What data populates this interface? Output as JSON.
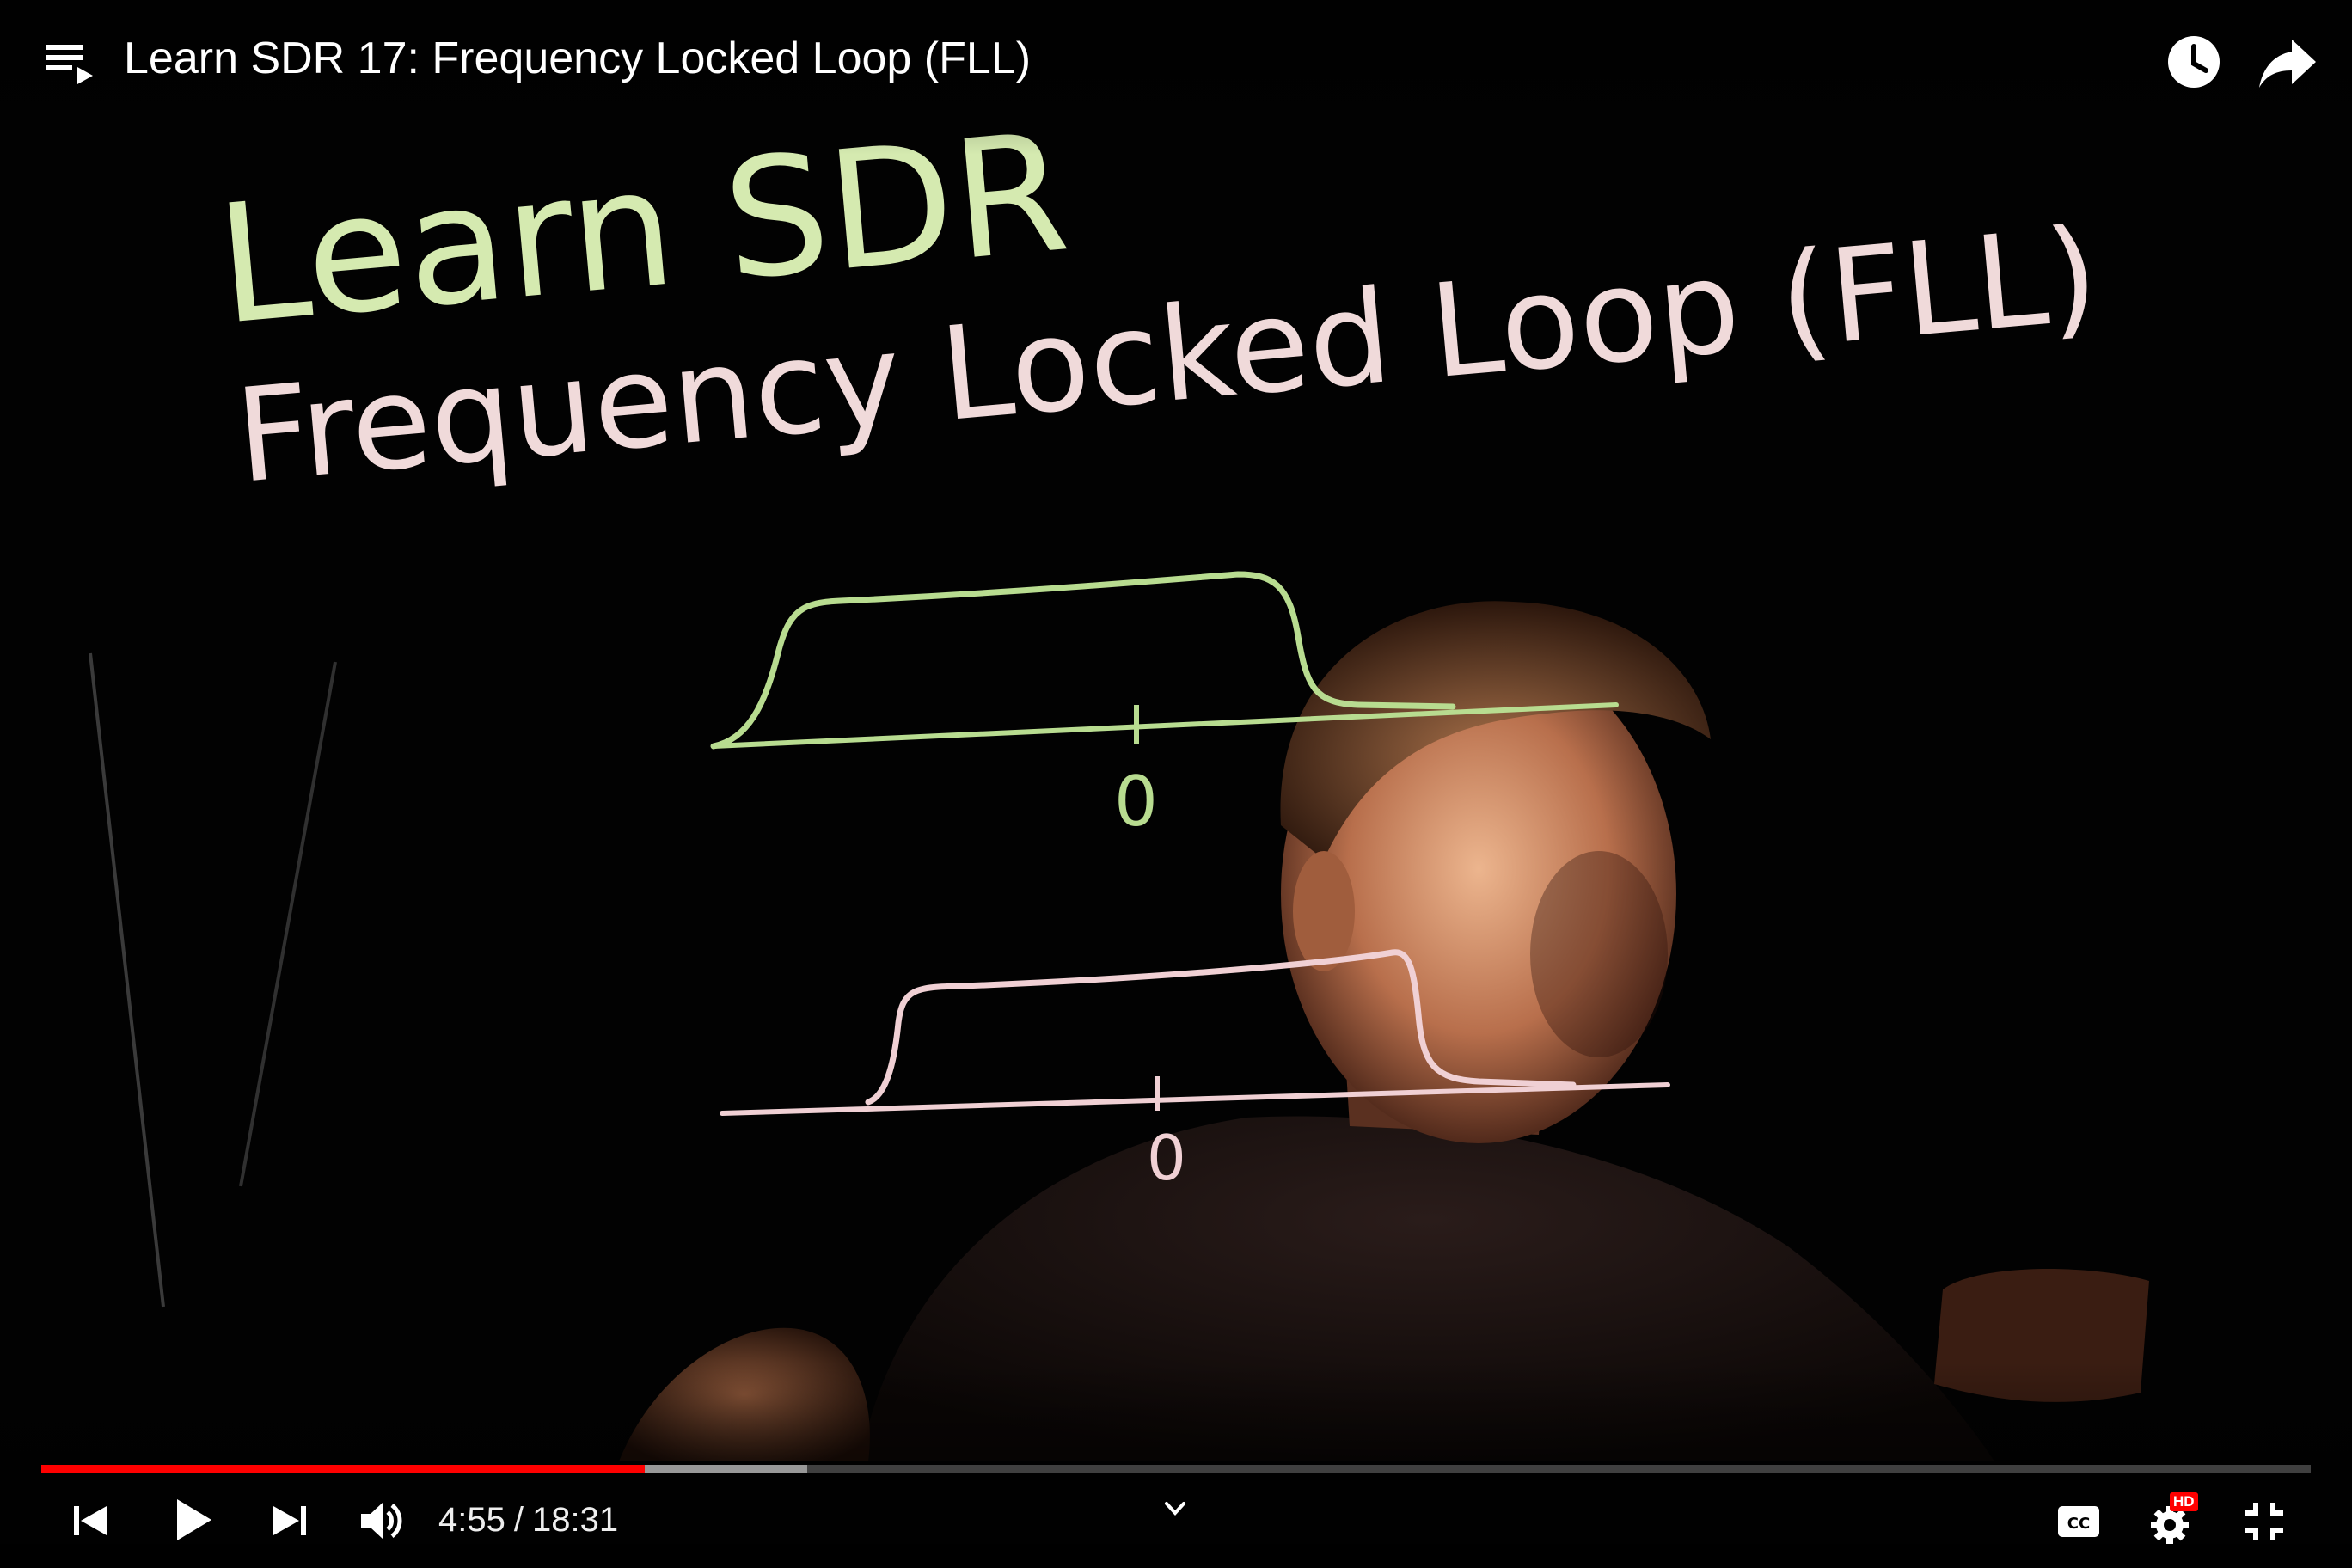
{
  "title_bar": {
    "video_title": "Learn SDR 17: Frequency Locked Loop (FLL)"
  },
  "video": {
    "board_line_1": "Learn SDR",
    "board_line_2": "Frequency Locked Loop (FLL)",
    "axis_label_top": "0",
    "axis_label_bottom": "0"
  },
  "progress": {
    "played_fraction": 0.266,
    "buffered_fraction": 0.3375
  },
  "controls": {
    "current_time": "4:55",
    "separator": "/",
    "duration": "18:31",
    "settings_badge": "HD"
  },
  "icons": {
    "playlist": "playlist-icon",
    "watch_later": "clock-icon",
    "share": "share-arrow-icon",
    "previous": "skip-previous-icon",
    "play": "play-icon",
    "next": "skip-next-icon",
    "volume": "volume-icon",
    "chevron": "chevron-down-icon",
    "captions": "captions-icon",
    "settings": "gear-icon",
    "exit_fullscreen": "exit-fullscreen-icon"
  },
  "colors": {
    "progress_played": "#ff0000",
    "chalk_green": "#c8e8a0",
    "chalk_pink": "#f2d2d6",
    "chalk_white": "#e8ecd8"
  }
}
